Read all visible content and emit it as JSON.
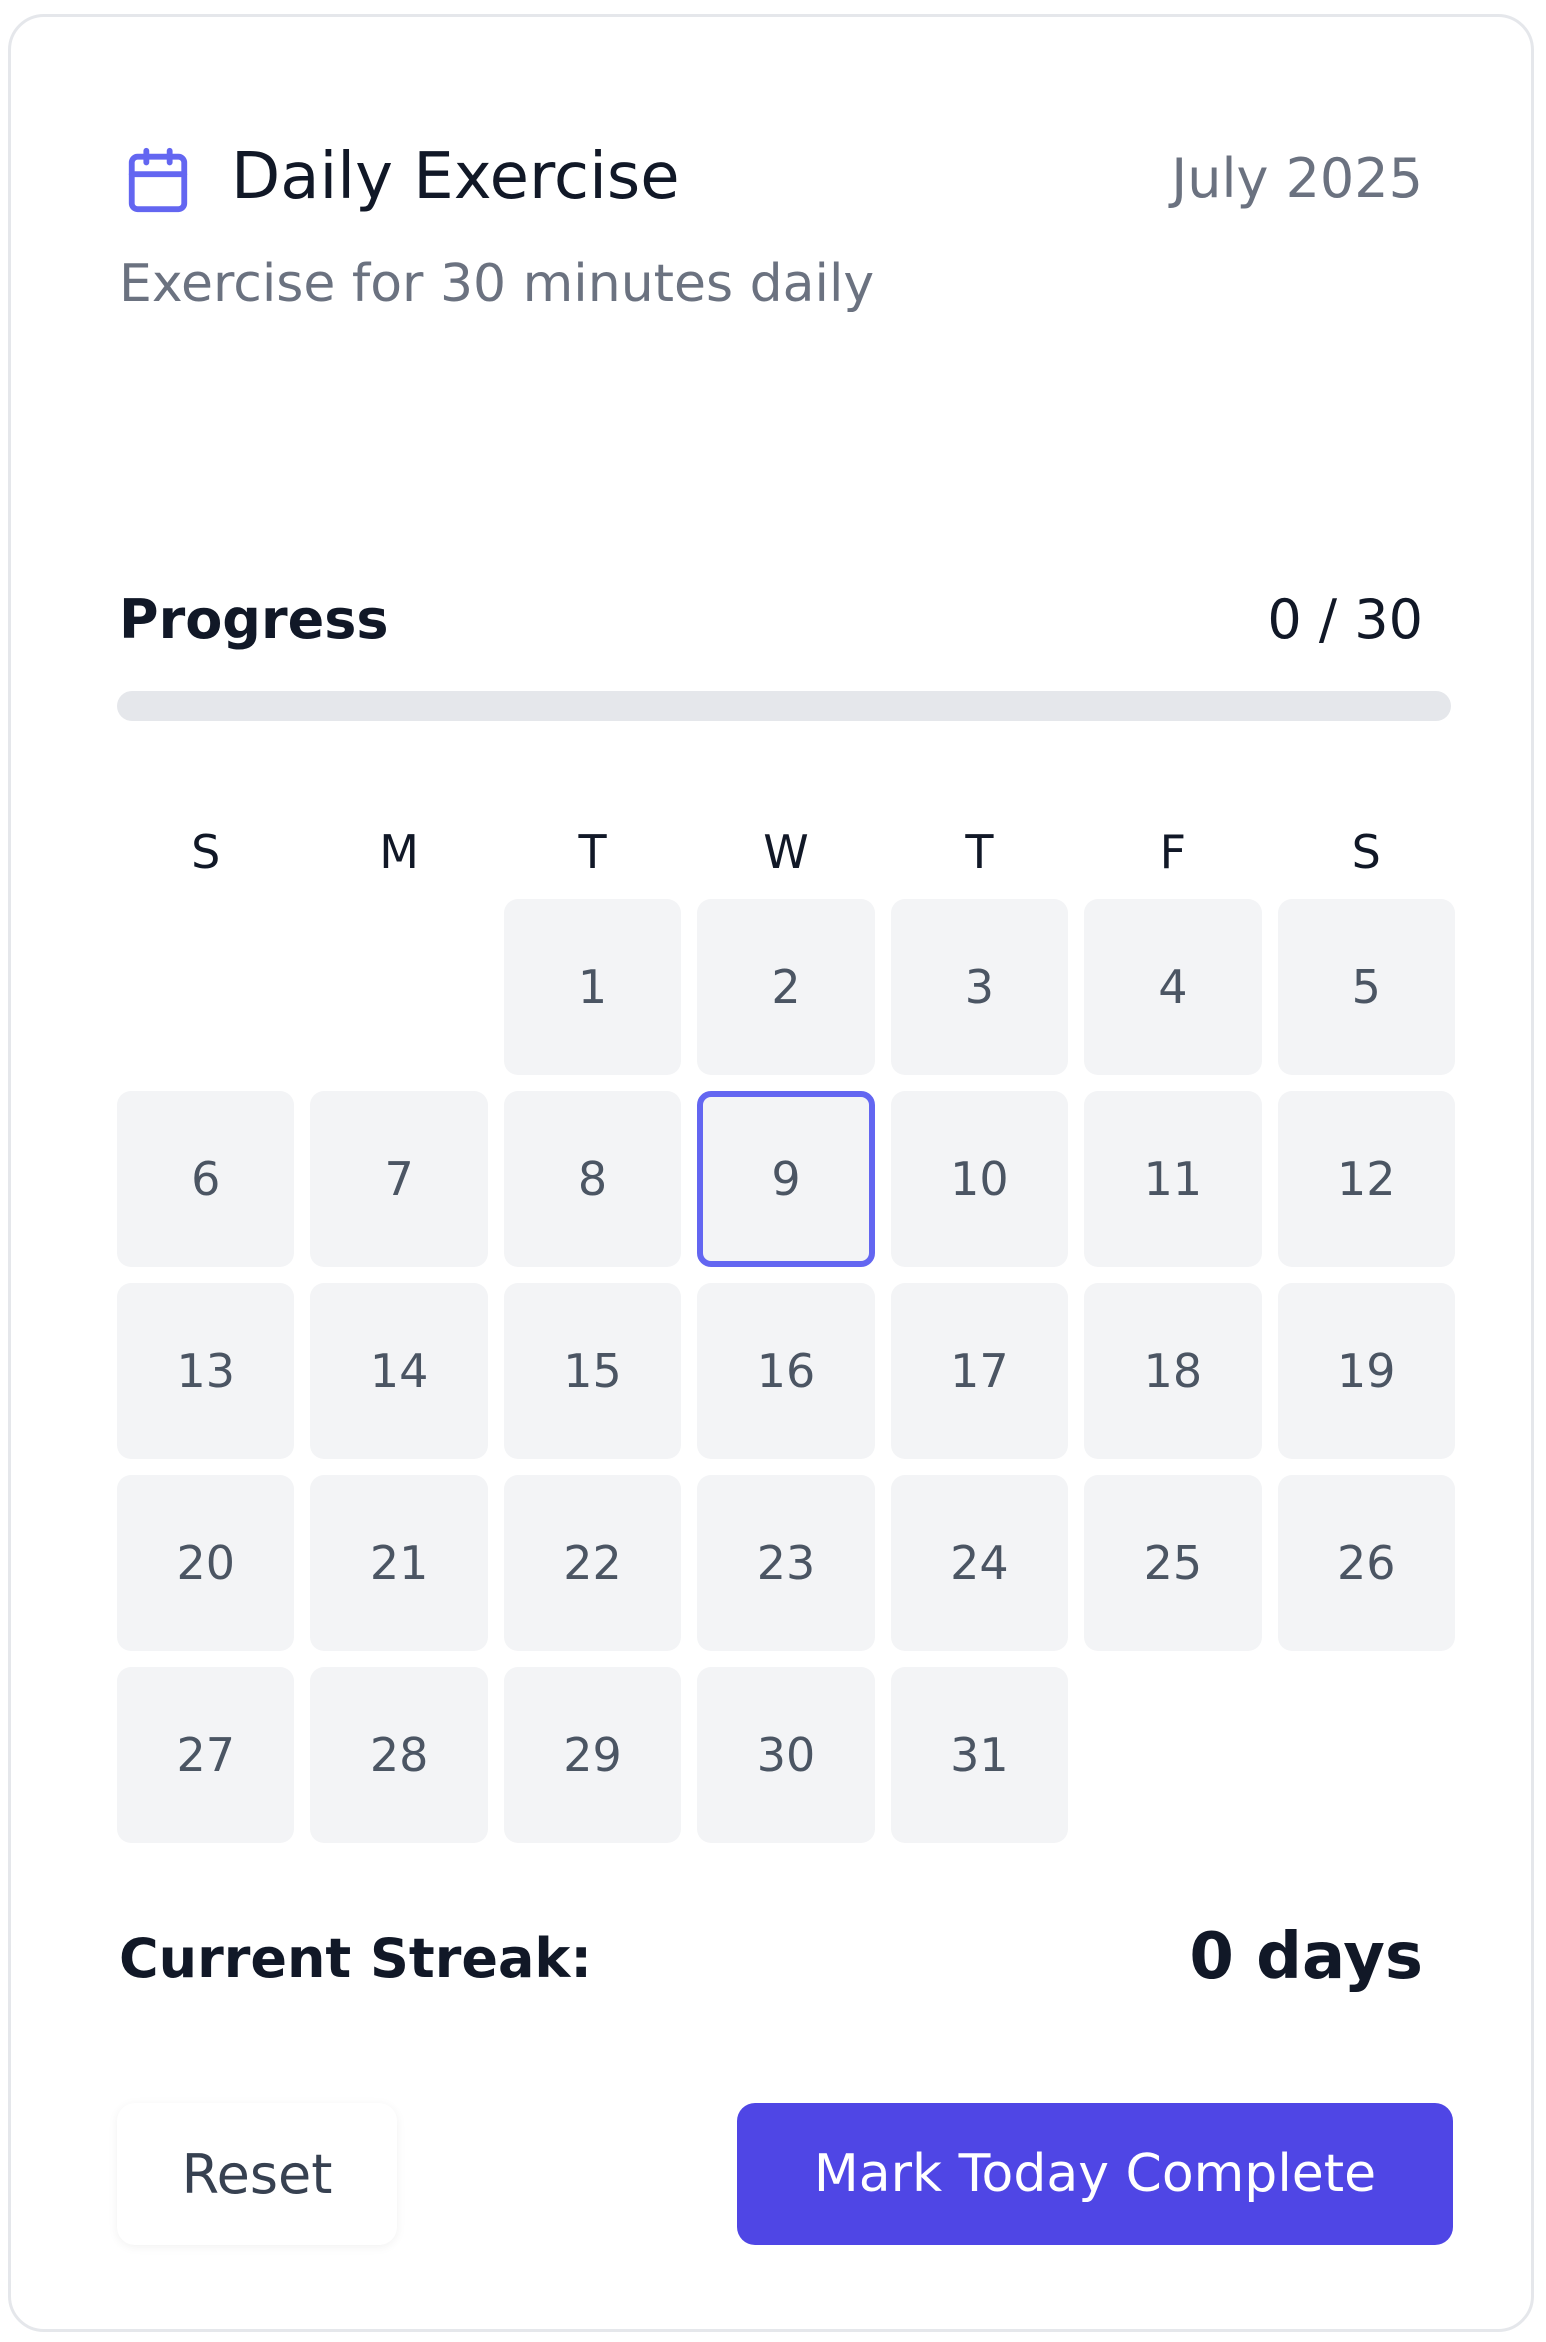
{
  "header": {
    "title": "Daily Exercise",
    "month": "July 2025",
    "description": "Exercise for 30 minutes daily",
    "icon": "calendar-icon",
    "accent_color": "#4f46e5",
    "icon_color": "#6366f1"
  },
  "progress": {
    "label": "Progress",
    "count_text": "0 / 30",
    "completed": 0,
    "target": 30,
    "fraction": 0
  },
  "calendar": {
    "weekdays": [
      "S",
      "M",
      "T",
      "W",
      "T",
      "F",
      "S"
    ],
    "leading_blanks": 2,
    "days": [
      "1",
      "2",
      "3",
      "4",
      "5",
      "6",
      "7",
      "8",
      "9",
      "10",
      "11",
      "12",
      "13",
      "14",
      "15",
      "16",
      "17",
      "18",
      "19",
      "20",
      "21",
      "22",
      "23",
      "24",
      "25",
      "26",
      "27",
      "28",
      "29",
      "30",
      "31"
    ],
    "today": "9"
  },
  "streak": {
    "label": "Current Streak:",
    "value": "0 days"
  },
  "actions": {
    "reset_label": "Reset",
    "complete_label": "Mark Today Complete"
  }
}
